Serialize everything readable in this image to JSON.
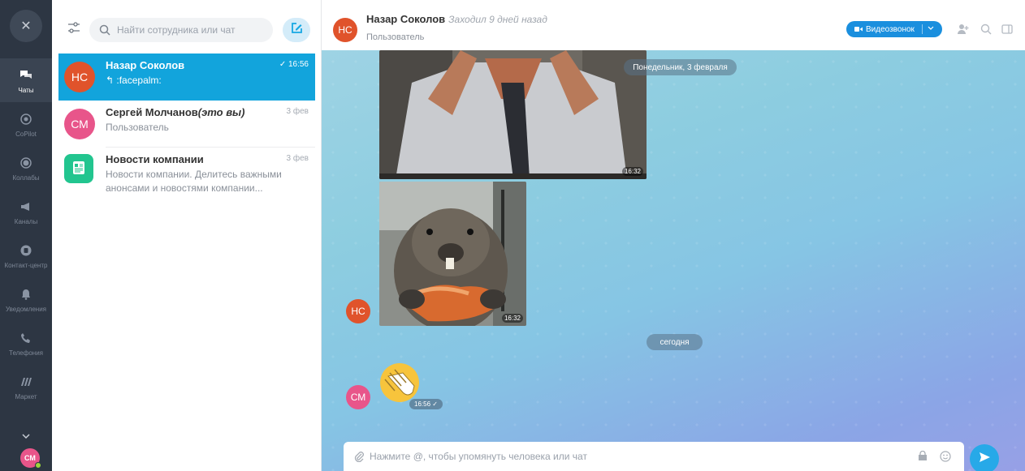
{
  "rail": {
    "items": [
      {
        "label": "Чаты"
      },
      {
        "label": "CoPilot"
      },
      {
        "label": "Коллабы"
      },
      {
        "label": "Каналы"
      },
      {
        "label": "Контакт-центр"
      },
      {
        "label": "Уведомления"
      },
      {
        "label": "Телефония"
      },
      {
        "label": "Маркет"
      }
    ],
    "user_initials": "СМ"
  },
  "chatlist": {
    "search_placeholder": "Найти сотрудника или чат",
    "chats": [
      {
        "initials": "НС",
        "name": "Назар Соколов",
        "preview": "↰ :facepalm:",
        "time": "✓ 16:56",
        "avatar_color": "#e0532b"
      },
      {
        "initials": "СМ",
        "name": "Сергей Молчанов",
        "name_suffix": "(это вы)",
        "preview": "Пользователь",
        "time": "3 фев",
        "avatar_color": "#e8558a"
      },
      {
        "name": "Новости компании",
        "preview_line1": "Новости компании. Делитесь важными",
        "preview_line2": "анонсами и новостями компании...",
        "time": "3 фев",
        "avatar_color": "#22c58f"
      }
    ]
  },
  "header": {
    "initials": "НС",
    "name": "Назар Соколов",
    "status": "Заходил 9 дней назад",
    "role": "Пользователь",
    "video_call_label": "Видеозвонок"
  },
  "conversation": {
    "date_monday": "Понедельник, 3 февраля",
    "date_today": "сегодня",
    "photo1_time": "16:32",
    "photo2_time": "16:32",
    "sender1_initials": "НС",
    "sender2_initials": "СМ",
    "emoji_time": "16:56 ✓"
  },
  "composer": {
    "placeholder": "Нажмите @, чтобы упомянуть человека или чат"
  },
  "colors": {
    "accent": "#12a4dc",
    "rail_bg": "#2d3643",
    "video_btn": "#1a8fde",
    "send_btn": "#27a9e8"
  }
}
